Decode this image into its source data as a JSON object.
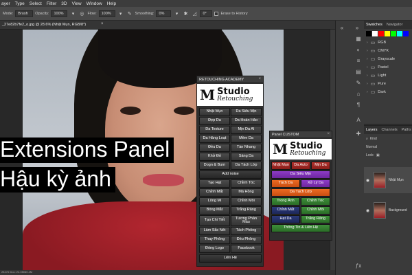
{
  "menubar": {
    "items": [
      "ayer",
      "Type",
      "Select",
      "Filter",
      "3D",
      "View",
      "Window",
      "Help"
    ]
  },
  "options": {
    "mode_label": "Mode:",
    "mode_value": "Brush",
    "opacity_label": "Opacity:",
    "opacity_value": "100%",
    "flow_label": "Flow:",
    "flow_value": "100%",
    "smoothing_label": "Smoothing:",
    "smoothing_value": "0%",
    "angle_value": "0°",
    "erase_history_label": "Erase to History"
  },
  "document": {
    "tab_title": "_27e82b7fe2_o.jpg @ 28.6% (Nhật Mụn, RGB/8*)",
    "tab_close": "×",
    "status": "28.6%  Doc: 24.0M/60.4M"
  },
  "overlay": {
    "line1": "Extensions Panel",
    "line2": "Hậu kỳ ảnh"
  },
  "swatches": {
    "tabs": [
      "Swatches",
      "Navigator"
    ],
    "colors": [
      "#000000",
      "#ffffff",
      "#ff0000",
      "#ffff00",
      "#00ff00",
      "#00ffff",
      "#0000ff"
    ],
    "folders": [
      "RGB",
      "CMYK",
      "Grayscale",
      "Pastel",
      "Light",
      "Pure",
      "Dark"
    ]
  },
  "layers": {
    "tabs": [
      "Layers",
      "Channels",
      "Paths"
    ],
    "kind_label": "Kind",
    "blend_mode": "Normal",
    "lock_label": "Lock:",
    "items": [
      {
        "name": "Nhật Mụn"
      },
      {
        "name": "Background"
      }
    ]
  },
  "academy_panel": {
    "title": "RETOUCHING ACADEMY",
    "logo_mark": "M",
    "logo_studio": "Studio",
    "logo_retouching": "Retouching",
    "buttons": [
      [
        "Nhật Mụn",
        "Da Siêu Mịn"
      ],
      [
        "Đẹp Da",
        "Da Hoàn Hảo"
      ],
      [
        "Da Texture",
        "Mịn Da AI"
      ],
      [
        "Da Hàng Loạt",
        "Mềm Da"
      ],
      [
        "Đều Da",
        "Tàn Nhang"
      ],
      [
        "Khử Đỏ",
        "Sáng Da"
      ],
      [
        "Dogn & Burn",
        "Da Tách Lớp"
      ]
    ],
    "add_noise": "Add noise",
    "buttons2": [
      [
        "Tạo Hạt",
        "Chỉnh Tóc"
      ],
      [
        "Chỉnh Mắt",
        "Má Hồng"
      ],
      [
        "Lông Mi",
        "Chỉnh Môi"
      ],
      [
        "Bóng Mắt",
        "Trắng Răng"
      ],
      [
        "Tạo Chi Tiết",
        "Tương Phản Màu"
      ],
      [
        "Làm Sắc Nét",
        "Tách Phông"
      ],
      [
        "Thay Phông",
        "Đều Phông"
      ],
      [
        "Đóng Logo",
        "Facebook"
      ]
    ],
    "contact": "Liên Hệ"
  },
  "custom_panel": {
    "title": "Panel CUSTOM",
    "logo_mark": "M",
    "logo_studio": "Studio",
    "logo_retouching": "Retouching",
    "row1": [
      "Nhật Mụn",
      "Da Auto",
      "Mịn Da"
    ],
    "da_sieu_min": "Da Siêu Mịn",
    "row3": [
      "Tách Da",
      "Xử Lý Da"
    ],
    "da_tach_lop": "Da Tách Lớp",
    "row5": [
      "Trong Ảnh",
      "Chỉnh Tóc"
    ],
    "row6": [
      "Chỉnh Mắt",
      "Chỉnh Môi"
    ],
    "row7": [
      "Hạt Da",
      "Trắng Răng"
    ],
    "contact": "Thông Tin & Liên Hệ"
  }
}
